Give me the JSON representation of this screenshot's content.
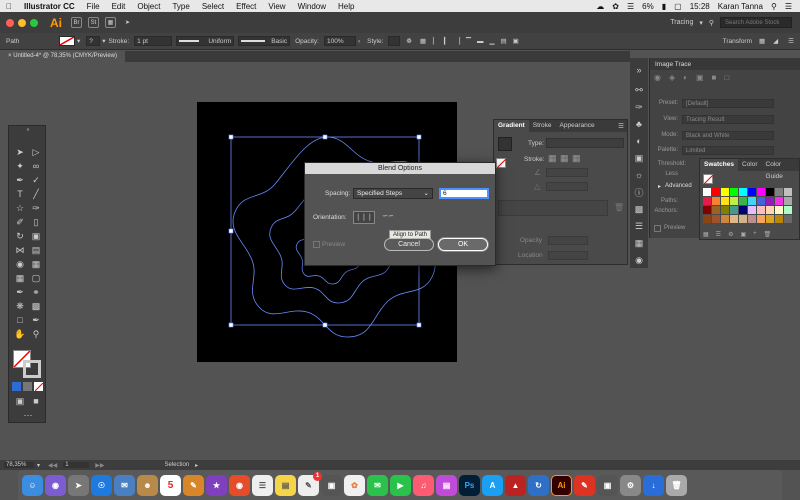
{
  "menubar": {
    "app_name": "Illustrator CC",
    "items": [
      "File",
      "Edit",
      "Object",
      "Type",
      "Select",
      "Effect",
      "View",
      "Window",
      "Help"
    ],
    "battery": "6%",
    "time": "15:28",
    "user": "Karan Tanna"
  },
  "appbar": {
    "logo": "Ai",
    "icons": [
      "Br",
      "St"
    ],
    "workspace": "Tracing",
    "search_placeholder": "Search Adobe Stock"
  },
  "controlbar": {
    "selection": "Path",
    "stroke_label": "Stroke:",
    "stroke_value": "1 pt",
    "profile": "Uniform",
    "brush": "Basic",
    "opacity_label": "Opacity:",
    "opacity_value": "100%",
    "style_label": "Style:",
    "transform": "Transform"
  },
  "document": {
    "tab_title": "Untitled-4* @ 78,35% (CMYK/Preview)"
  },
  "image_trace": {
    "title": "Image Trace",
    "rows": [
      {
        "label": "Preset:",
        "value": "[Default]"
      },
      {
        "label": "View:",
        "value": "Tracing Result"
      },
      {
        "label": "Mode:",
        "value": "Black and White"
      },
      {
        "label": "Palette:",
        "value": "Limited"
      },
      {
        "label": "Threshold:",
        "value": ""
      },
      {
        "label": "Less",
        "value": ""
      },
      {
        "label": "Advanced",
        "value": ""
      },
      {
        "label": "Paths:",
        "value": ""
      },
      {
        "label": "Anchors:",
        "value": ""
      },
      {
        "label": "Preview",
        "value": ""
      }
    ]
  },
  "gradient_panel": {
    "tabs": [
      "Gradient",
      "Stroke",
      "Appearance"
    ],
    "type_label": "Type:",
    "stroke_label": "Stroke:",
    "opacity_label": "Opacity",
    "location_label": "Location"
  },
  "swatches_panel": {
    "tabs": [
      "Swatches",
      "Color",
      "Color Guide"
    ],
    "colors": [
      "#ffffff",
      "#ff0000",
      "#ffff00",
      "#00ff00",
      "#00ffff",
      "#0000ff",
      "#ff00ff",
      "#000000",
      "#808080",
      "#c0c0c0",
      "#e6194b",
      "#f58231",
      "#ffe119",
      "#bfef45",
      "#3cb44b",
      "#42d4f4",
      "#4363d8",
      "#911eb4",
      "#f032e6",
      "#a9a9a9",
      "#800000",
      "#9a6324",
      "#808000",
      "#469990",
      "#000075",
      "#e6beff",
      "#fabebe",
      "#ffd8b1",
      "#fffac8",
      "#aaffc3",
      "#8b4513",
      "#a0522d",
      "#cd853f",
      "#deb887",
      "#d2b48c",
      "#bc8f8f",
      "#f4a460",
      "#daa520",
      "#b8860b",
      "#696969"
    ]
  },
  "dialog": {
    "title": "Blend Options",
    "spacing_label": "Spacing:",
    "spacing_value": "Specified Steps",
    "steps_value": "6",
    "orientation_label": "Orientation:",
    "tooltip": "Align to Path",
    "preview_label": "Preview",
    "cancel_label": "Cancel",
    "ok_label": "OK"
  },
  "statusbar": {
    "zoom": "78,35%",
    "page": "1",
    "tool": "Selection"
  },
  "dock": {
    "calendar_day": "5",
    "badge": "1",
    "app_labels": {
      "photoshop": "Ps",
      "illustrator": "Ai"
    }
  }
}
